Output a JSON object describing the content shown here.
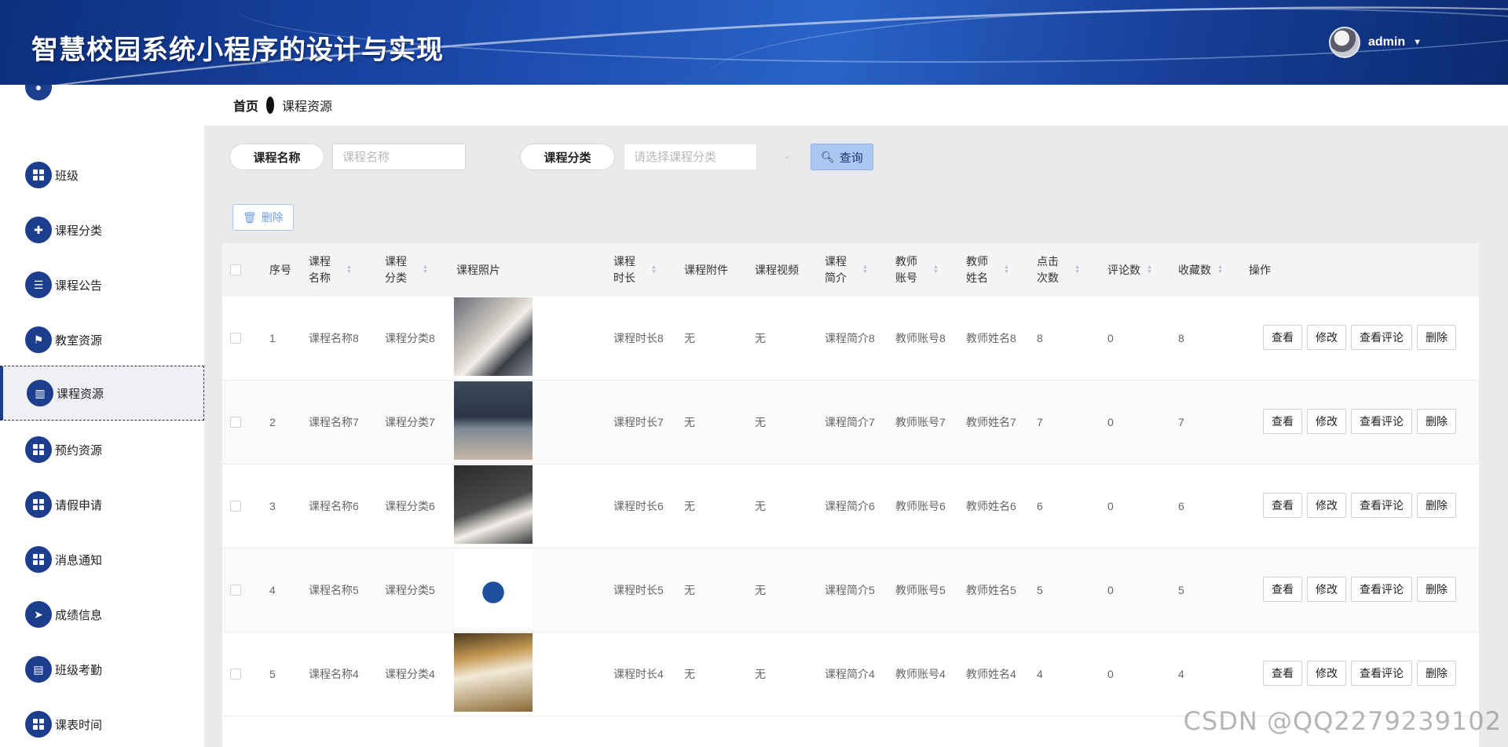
{
  "header": {
    "title": "智慧校园系统小程序的设计与实现",
    "user": "admin",
    "dropdown_icon": "caret-down-icon"
  },
  "breadcrumb": {
    "home": "首页",
    "current": "课程资源"
  },
  "sidebar": {
    "items": [
      {
        "label": "",
        "icon": "user-icon"
      },
      {
        "label": "班级",
        "icon": "grid-icon"
      },
      {
        "label": "课程分类",
        "icon": "puzzle-icon"
      },
      {
        "label": "课程公告",
        "icon": "list-icon"
      },
      {
        "label": "教室资源",
        "icon": "flag-icon"
      },
      {
        "label": "课程资源",
        "icon": "book-icon",
        "active": true
      },
      {
        "label": "预约资源",
        "icon": "grid-icon"
      },
      {
        "label": "请假申请",
        "icon": "grid-icon"
      },
      {
        "label": "消息通知",
        "icon": "grid-icon"
      },
      {
        "label": "成绩信息",
        "icon": "send-icon"
      },
      {
        "label": "班级考勤",
        "icon": "clipboard-icon"
      },
      {
        "label": "课表时间",
        "icon": "grid-icon"
      }
    ]
  },
  "search": {
    "name_label": "课程名称",
    "name_placeholder": "课程名称",
    "category_label": "课程分类",
    "category_placeholder": "请选择课程分类",
    "query_button": "查询"
  },
  "toolbar": {
    "delete_button": "删除"
  },
  "table": {
    "columns": [
      "序号",
      "课程名称",
      "课程分类",
      "课程照片",
      "课程时长",
      "课程附件",
      "课程视频",
      "课程简介",
      "教师账号",
      "教师姓名",
      "点击次数",
      "评论数",
      "收藏数",
      "操作"
    ],
    "rows": [
      {
        "index": "1",
        "name": "课程名称8",
        "category": "课程分类8",
        "duration": "课程时长8",
        "attachment": "无",
        "video": "无",
        "intro": "课程简介8",
        "teacher_account": "教师账号8",
        "teacher_name": "教师姓名8",
        "clicks": "8",
        "comments": "0",
        "favorites": "8"
      },
      {
        "index": "2",
        "name": "课程名称7",
        "category": "课程分类7",
        "duration": "课程时长7",
        "attachment": "无",
        "video": "无",
        "intro": "课程简介7",
        "teacher_account": "教师账号7",
        "teacher_name": "教师姓名7",
        "clicks": "7",
        "comments": "0",
        "favorites": "7"
      },
      {
        "index": "3",
        "name": "课程名称6",
        "category": "课程分类6",
        "duration": "课程时长6",
        "attachment": "无",
        "video": "无",
        "intro": "课程简介6",
        "teacher_account": "教师账号6",
        "teacher_name": "教师姓名6",
        "clicks": "6",
        "comments": "0",
        "favorites": "6"
      },
      {
        "index": "4",
        "name": "课程名称5",
        "category": "课程分类5",
        "duration": "课程时长5",
        "attachment": "无",
        "video": "无",
        "intro": "课程简介5",
        "teacher_account": "教师账号5",
        "teacher_name": "教师姓名5",
        "clicks": "5",
        "comments": "0",
        "favorites": "5"
      },
      {
        "index": "5",
        "name": "课程名称4",
        "category": "课程分类4",
        "duration": "课程时长4",
        "attachment": "无",
        "video": "无",
        "intro": "课程简介4",
        "teacher_account": "教师账号4",
        "teacher_name": "教师姓名4",
        "clicks": "4",
        "comments": "0",
        "favorites": "4"
      }
    ],
    "row_actions": [
      "查看",
      "修改",
      "查看评论",
      "删除"
    ]
  },
  "watermark": "CSDN @QQ2279239102",
  "colors": {
    "brand": "#1d3e8c",
    "query_button": "#a9c8f2",
    "header_dark": "#0d2f7c"
  }
}
